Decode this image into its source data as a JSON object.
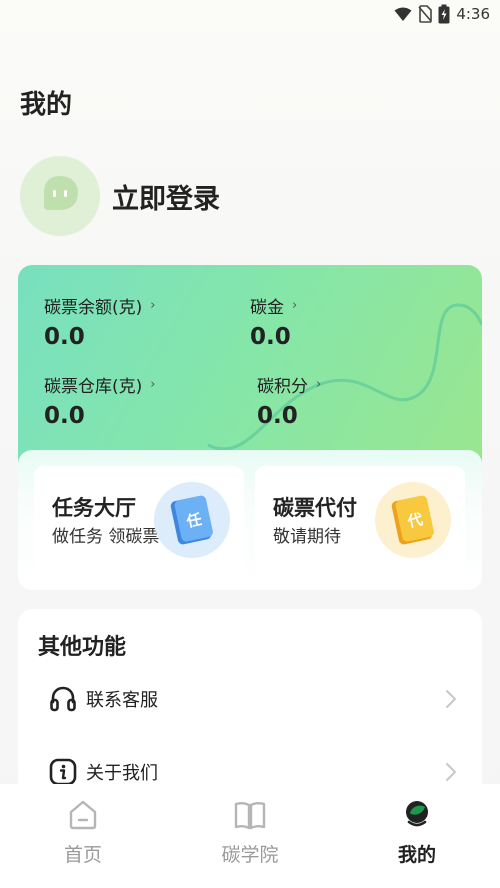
{
  "status_bar": {
    "time": "4:36",
    "icons": [
      "wifi-icon",
      "no-sim-icon",
      "battery-charging-icon"
    ]
  },
  "page": {
    "title": "我的"
  },
  "profile": {
    "avatar_icon": "chat-face-icon",
    "login_label": "立即登录"
  },
  "wallet": {
    "stats": [
      {
        "label": "碳票余额(克)",
        "value": "0.0"
      },
      {
        "label": "碳金",
        "value": "0.0"
      },
      {
        "label": "碳票仓库(克)",
        "value": "0.0"
      },
      {
        "label": "碳积分",
        "value": "0.0"
      }
    ],
    "chevron": "›"
  },
  "services": [
    {
      "title": "任务大厅",
      "subtitle": "做任务 领碳票",
      "icon": "task-book-icon",
      "icon_glyph": "任"
    },
    {
      "title": "碳票代付",
      "subtitle": "敬请期待",
      "icon": "pay-book-icon",
      "icon_glyph": "代"
    }
  ],
  "other": {
    "title": "其他功能",
    "items": [
      {
        "label": "联系客服",
        "icon": "headset-icon"
      },
      {
        "label": "关于我们",
        "icon": "info-icon"
      }
    ]
  },
  "tabs": [
    {
      "label": "首页",
      "icon": "home-icon",
      "active": false
    },
    {
      "label": "碳学院",
      "icon": "book-open-icon",
      "active": false
    },
    {
      "label": "我的",
      "icon": "profile-leaf-icon",
      "active": true
    }
  ],
  "colors": {
    "accent_green": "#1a9a4a",
    "card_gradient_start": "#78e0c0",
    "card_gradient_end": "#9ae68f",
    "task_icon_blue": "#5aa0ee",
    "pay_icon_yellow": "#f6c23a"
  }
}
